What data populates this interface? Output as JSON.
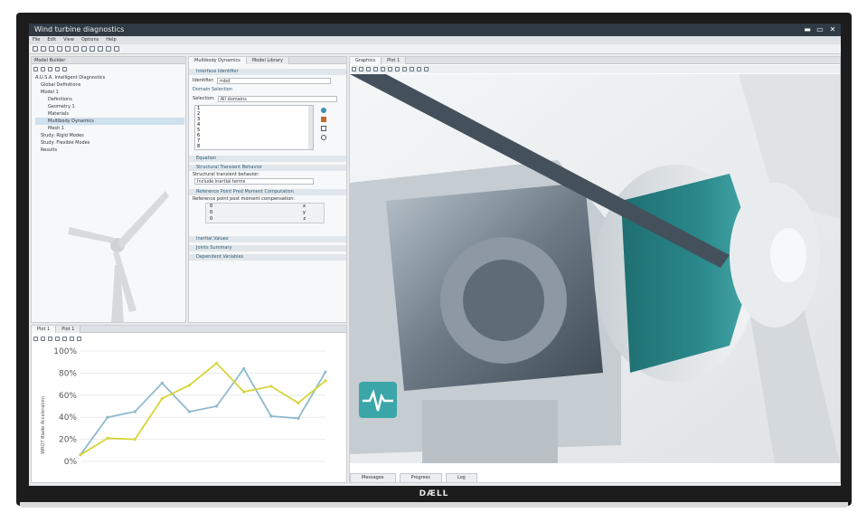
{
  "window": {
    "title": "Wind turbine diagnostics",
    "controls": [
      "▬",
      "▭",
      "✕"
    ]
  },
  "menu": [
    "File",
    "Edit",
    "View",
    "Options",
    "Help"
  ],
  "brand": "DÆLL",
  "model_builder": {
    "title": "Model Builder",
    "tree": [
      {
        "label": "A.U.S.A. Intelligent Diagnostics",
        "level": 0
      },
      {
        "label": "Global Definitions",
        "level": 1
      },
      {
        "label": "Model 1",
        "level": 1
      },
      {
        "label": "Definitions",
        "level": 2
      },
      {
        "label": "Geometry 1",
        "level": 2
      },
      {
        "label": "Materials",
        "level": 2
      },
      {
        "label": "Multibody Dynamics",
        "level": 2,
        "selected": true
      },
      {
        "label": "Mesh 1",
        "level": 2
      },
      {
        "label": "Study: Rigid Modes",
        "level": 1
      },
      {
        "label": "Study: Flexible Modes",
        "level": 1
      },
      {
        "label": "Results",
        "level": 1
      }
    ]
  },
  "settings": {
    "tabs": [
      "Multibody Dynamics",
      "Model Library"
    ],
    "sections": {
      "interface": "Interface Identifier",
      "identifier_label": "Identifier:",
      "identifier_value": "mbd",
      "domain": "Domain Selection",
      "selection_label": "Selection:",
      "selection_value": "All domains",
      "list": [
        "1",
        "2",
        "3",
        "4",
        "5",
        "6",
        "7",
        "8"
      ],
      "equation": "Equation",
      "structural": "Structural Transient Behavior",
      "structural_label": "Structural transient behavior:",
      "structural_value": "Include inertial terms",
      "reference": "Reference Point Pred Moment Computation",
      "reference_label": "Reference point post moment compensation:",
      "ref_rows": [
        [
          "0",
          "x"
        ],
        [
          "0",
          "y"
        ],
        [
          "0",
          "z"
        ]
      ],
      "inertia": "Inertial Values",
      "joints": "Joints Summary",
      "dependent": "Dependent Variables"
    }
  },
  "graphics": {
    "tabs": [
      "Graphics",
      "Plot 1"
    ]
  },
  "plot": {
    "tabs": [
      "Plot 1",
      "Plot 1"
    ]
  },
  "chart_data": {
    "type": "line",
    "ylabel": "WROT Blade Acceleration",
    "ylim": [
      0,
      100
    ],
    "yticks": [
      "100%",
      "80%",
      "60%",
      "40%",
      "20%",
      "0%"
    ],
    "x": [
      0,
      1,
      2,
      3,
      4,
      5,
      6,
      7,
      8,
      9
    ],
    "series": [
      {
        "name": "",
        "color": "#8fbacd",
        "values": [
          6,
          40,
          45,
          71,
          45,
          50,
          84,
          41,
          39,
          81
        ]
      },
      {
        "name": "",
        "color": "#d8d43a",
        "values": [
          6,
          21,
          20,
          57,
          69,
          89,
          63,
          68,
          53,
          73
        ]
      }
    ]
  },
  "bottom_tabs": [
    "Messages",
    "Progress",
    "Log"
  ],
  "colors": {
    "titlebar": "#2f3a44",
    "accent": "#2a8a8c",
    "pulse_icon": "#3aa6a8"
  }
}
